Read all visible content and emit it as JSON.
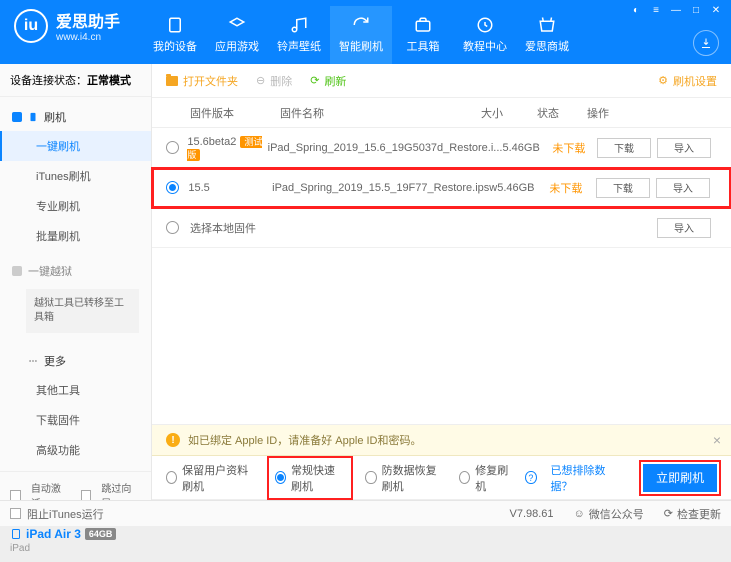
{
  "brand": {
    "title": "爱思助手",
    "sub": "www.i4.cn"
  },
  "nav": [
    "我的设备",
    "应用游戏",
    "铃声壁纸",
    "智能刷机",
    "工具箱",
    "教程中心",
    "爱思商城"
  ],
  "conn": {
    "label": "设备连接状态：",
    "value": "正常模式"
  },
  "side": {
    "flash": "刷机",
    "items": [
      "一键刷机",
      "iTunes刷机",
      "专业刷机",
      "批量刷机"
    ],
    "jailbreak": "一键越狱",
    "note": "越狱工具已转移至工具箱",
    "more": "更多",
    "more_items": [
      "其他工具",
      "下载固件",
      "高级功能"
    ],
    "auto_activate": "自动激活",
    "skip_guide": "跳过向导"
  },
  "device": {
    "name": "iPad Air 3",
    "storage": "64GB",
    "model": "iPad"
  },
  "toolbar": {
    "open": "打开文件夹",
    "delete": "删除",
    "refresh": "刷新",
    "settings": "刷机设置"
  },
  "thead": {
    "ver": "固件版本",
    "name": "固件名称",
    "size": "大小",
    "status": "状态",
    "ops": "操作"
  },
  "rows": [
    {
      "ver": "15.6beta2",
      "tag": "测试版",
      "name": "iPad_Spring_2019_15.6_19G5037d_Restore.i...",
      "size": "5.46GB",
      "status": "未下载",
      "selected": false
    },
    {
      "ver": "15.5",
      "tag": "",
      "name": "iPad_Spring_2019_15.5_19F77_Restore.ipsw",
      "size": "5.46GB",
      "status": "未下载",
      "selected": true
    }
  ],
  "local_row": "选择本地固件",
  "btn": {
    "download": "下载",
    "import": "导入"
  },
  "warn": "如已绑定 Apple ID，请准备好 Apple ID和密码。",
  "opts": [
    "保留用户资料刷机",
    "常规快速刷机",
    "防数据恢复刷机",
    "修复刷机"
  ],
  "opts_link": "已想排除数据？",
  "primary": "立即刷机",
  "footer": {
    "block": "阻止iTunes运行",
    "ver": "V7.98.61",
    "wechat": "微信公众号",
    "update": "检查更新"
  }
}
